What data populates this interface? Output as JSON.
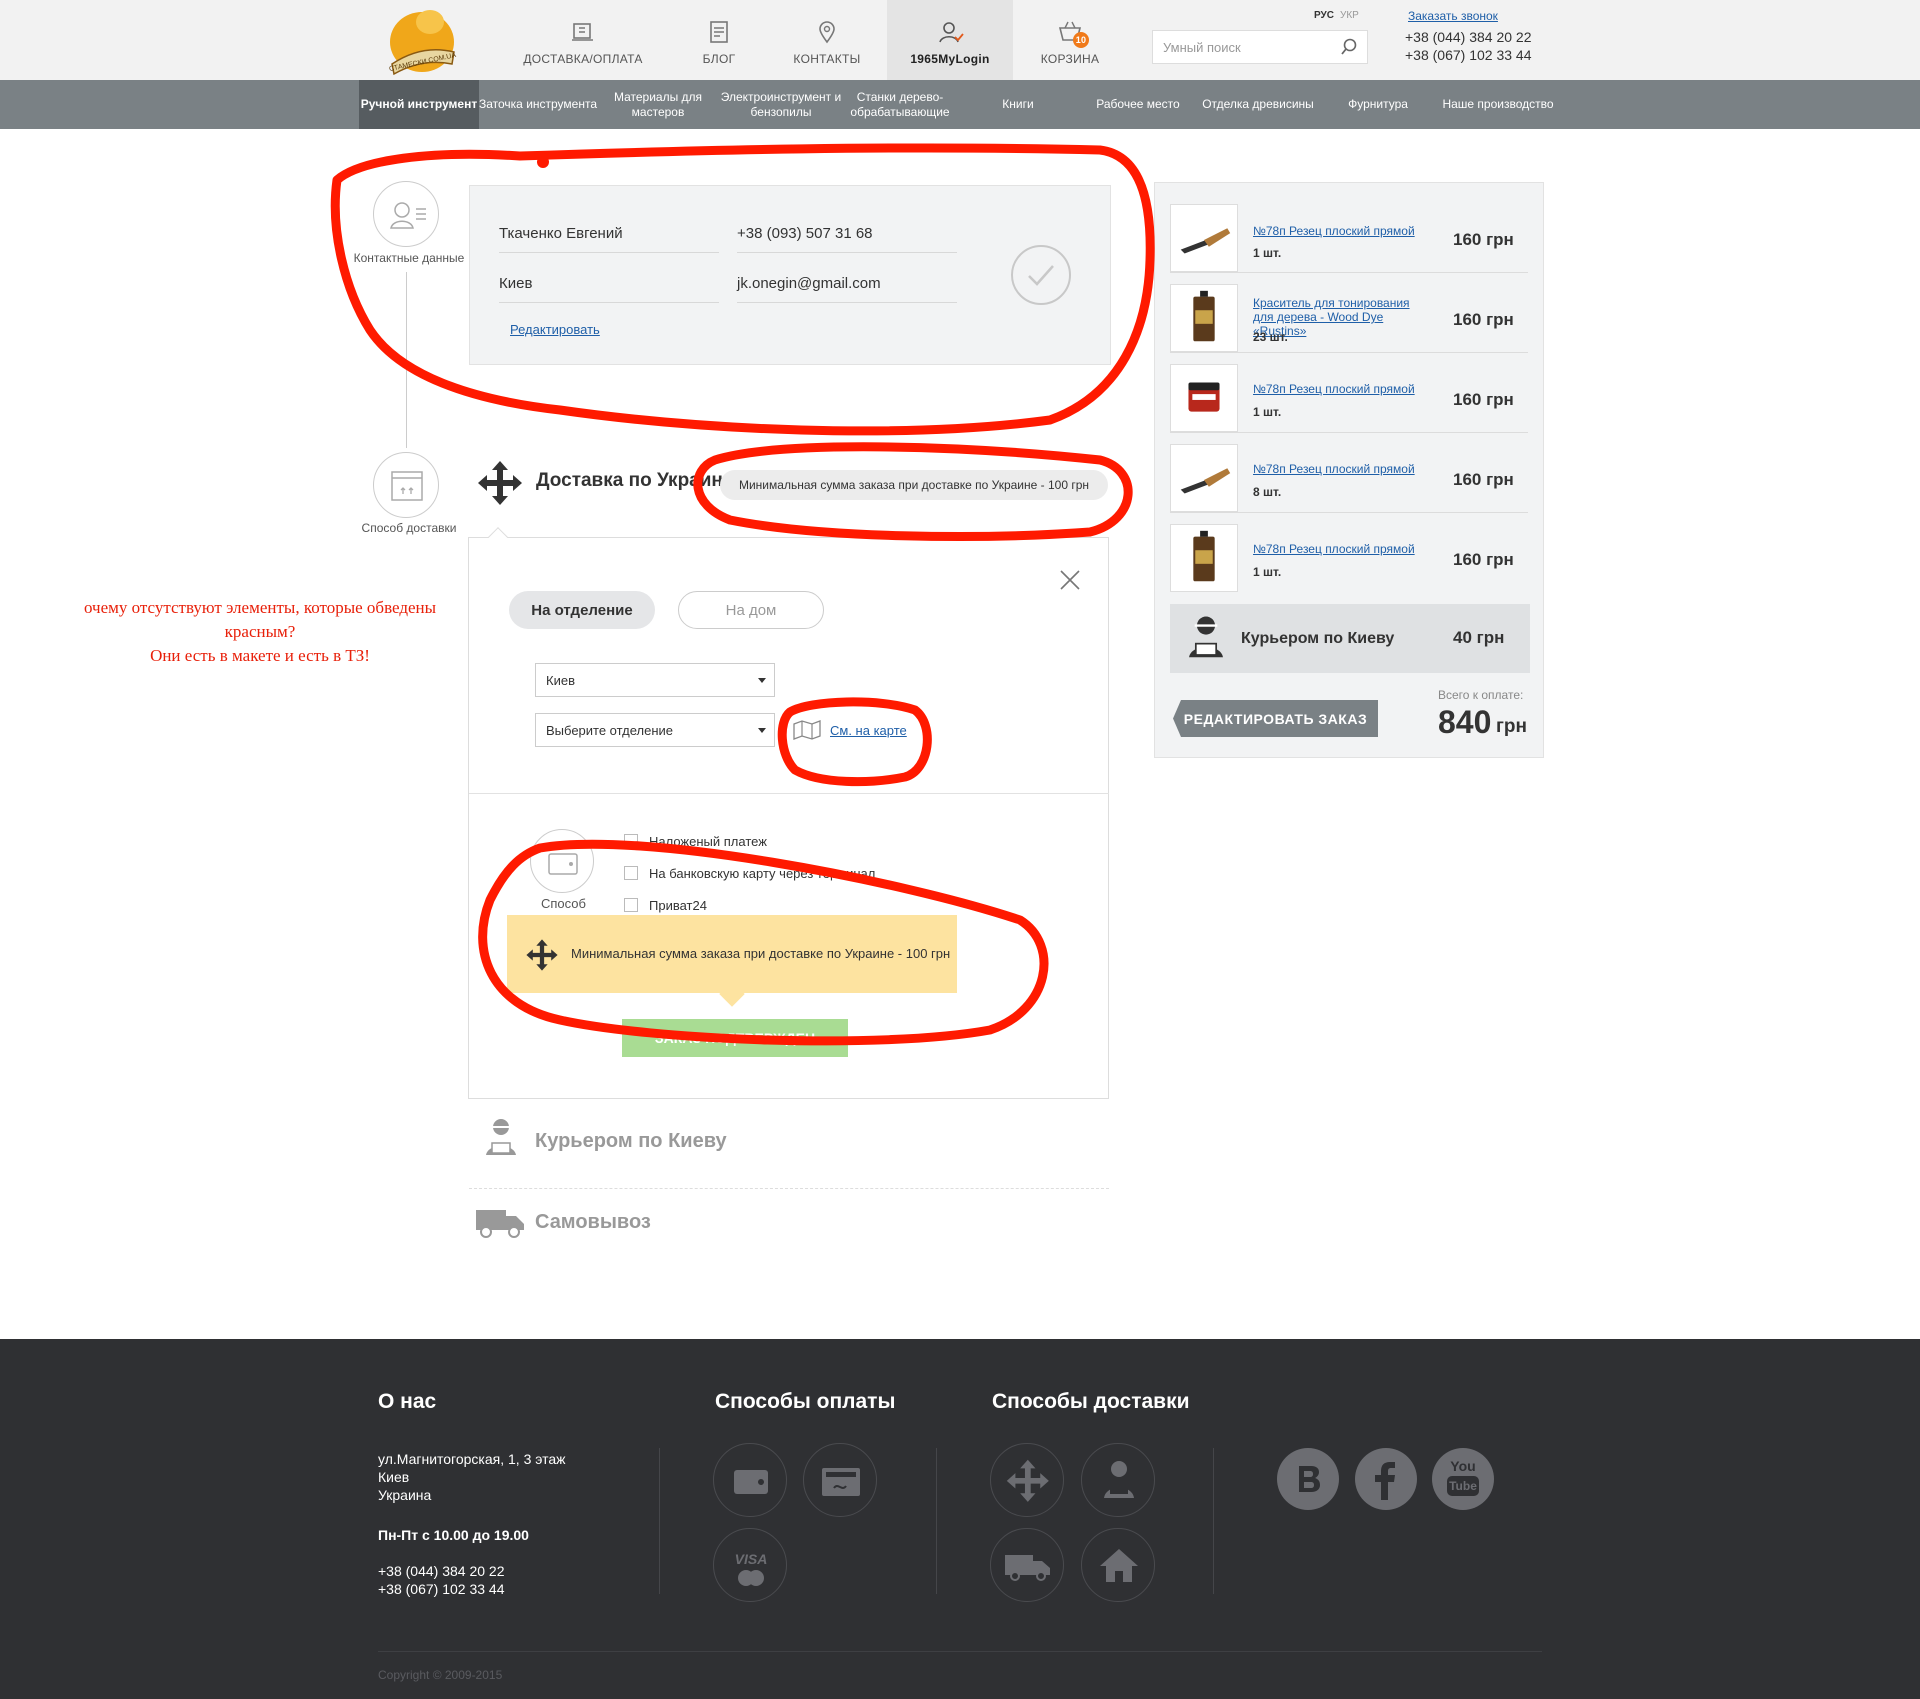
{
  "header": {
    "logo_text": "СТАМЕСКИ.COM.UA",
    "nav": [
      {
        "label": "ДОСТАВКА/ОПЛАТА",
        "icon": "delivery-icon"
      },
      {
        "label": "БЛОГ",
        "icon": "blog-icon"
      },
      {
        "label": "КОНТАКТЫ",
        "icon": "map-pin-icon"
      },
      {
        "label": "1965MyLogin",
        "icon": "user-icon"
      },
      {
        "label": "КОРЗИНА",
        "icon": "cart-icon",
        "badge": "10"
      }
    ],
    "lang_active": "РУС",
    "lang_other": "УКР",
    "search_placeholder": "Умный поиск",
    "callback": "Заказать звонок",
    "phone1": "+38 (044) 384 20 22",
    "phone2": "+38 (067) 102 33 44"
  },
  "categories": [
    "Ручной инструмент",
    "Заточка инструмента",
    "Материалы для мастеров",
    "Электроинструмент и бензопилы",
    "Станки дерево-обрабатывающие",
    "Книги",
    "Рабочее место",
    "Отделка древисины",
    "Фурнитура",
    "Наше производство"
  ],
  "steps": {
    "contact_label": "Контактные данные",
    "delivery_label": "Способ доставки",
    "payment_label": "Способ"
  },
  "contact": {
    "name": "Ткаченко Евгений",
    "phone": "+38 (093) 507 31 68",
    "city": "Киев",
    "email": "jk.onegin@gmail.com",
    "edit": "Редактировать"
  },
  "delivery": {
    "title": "Доставка по Украине",
    "min_order_note": "Минимальная сумма заказа при доставке по Украине - 100 грн",
    "tab_branch": "На отделение",
    "tab_home": "На дом",
    "city_select": "Киев",
    "branch_select": "Выберите отделение",
    "map_link": "См. на карте",
    "payment_options": [
      "Наложеный платеж",
      "На банковскую карту через терминал",
      "Приват24"
    ],
    "tooltip": "Минимальная сумма заказа при доставке по Украине - 100 грн",
    "confirm_button": "ЗАКАЗ ПОДТВЕРЖДЕН",
    "courier": "Курьером по Киеву",
    "pickup": "Самовывоз"
  },
  "annotation": {
    "line1": "очему отсутствуют элементы, которые обведены",
    "line2": "красным?",
    "line3": "Они есть в макете и есть в ТЗ!"
  },
  "cart": {
    "items": [
      {
        "title": "№78п Резец плоский прямой",
        "qty": "1 шт.",
        "price": "160 грн"
      },
      {
        "title": "Краситель для тонирования для дерева - Wood Dye «Rustins»",
        "qty": "23 шт.",
        "price": "160 грн"
      },
      {
        "title": "№78п Резец плоский прямой",
        "qty": "1 шт.",
        "price": "160 грн"
      },
      {
        "title": "№78п Резец плоский прямой",
        "qty": "8 шт.",
        "price": "160 грн"
      },
      {
        "title": "№78п Резец плоский прямой",
        "qty": "1 шт.",
        "price": "160 грн"
      }
    ],
    "delivery_name": "Курьером по Киеву",
    "delivery_price": "40 грн",
    "edit_button": "РЕДАКТИРОВАТЬ ЗАКАЗ",
    "total_label": "Всего к оплате:",
    "total_value": "840",
    "total_currency": "грн"
  },
  "footer": {
    "about_title": "О нас",
    "address1": "ул.Магнитогорская, 1, 3 этаж",
    "address2": "Киев",
    "address3": "Украина",
    "hours": "Пн-Пт с 10.00 до 19.00",
    "phone1": "+38 (044) 384 20 22",
    "phone2": "+38 (067) 102 33 44",
    "payment_title": "Способы оплаты",
    "delivery_title": "Способы доставки",
    "visa": "VISA",
    "youtube_you": "You",
    "youtube_tube": "Tube",
    "copyright": "Copyright © 2009-2015"
  },
  "colors": {
    "nav_bg": "#7a8185",
    "nav_active": "#565c60",
    "footer_bg": "#2f3033",
    "annotation_red": "#ff1a00",
    "tooltip_yellow": "#fde3a0",
    "confirm_green": "#a9dc93",
    "badge_orange": "#f07a1a"
  }
}
